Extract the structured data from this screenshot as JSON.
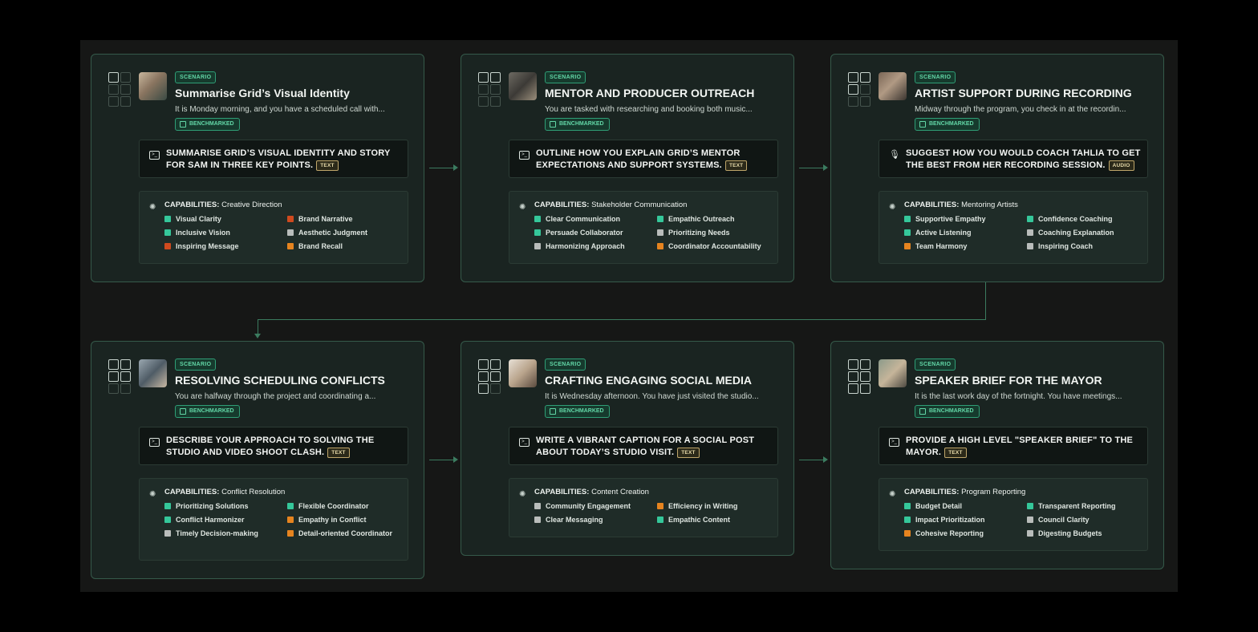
{
  "colors": {
    "green": "#35c79a",
    "orange": "#e6841f",
    "red": "#cf4a1e",
    "gray": "#b9bdbb",
    "connector": "#3b7b5f"
  },
  "labels": {
    "scenario": "SCENARIO",
    "benchmarked": "BENCHMARKED",
    "capabilities_prefix": "CAPABILITIES:"
  },
  "cards": [
    {
      "title": "Summarise Grid’s Visual Identity",
      "description": "It is Monday morning, and you have a scheduled call with...",
      "task_icon": "terminal-icon",
      "task": "SUMMARISE GRID’S VISUAL IDENTITY AND STORY FOR SAM IN THREE KEY POINTS.",
      "mode": "TEXT",
      "capability_area": "Creative Direction",
      "grid_icon_on": [
        true,
        false,
        false,
        false,
        false,
        false
      ],
      "capabilities": [
        {
          "label": "Visual Clarity",
          "color": "green"
        },
        {
          "label": "Brand Narrative",
          "color": "red"
        },
        {
          "label": "Inclusive Vision",
          "color": "green"
        },
        {
          "label": "Aesthetic Judgment",
          "color": "gray"
        },
        {
          "label": "Inspiring Message",
          "color": "red"
        },
        {
          "label": "Brand Recall",
          "color": "orange"
        }
      ]
    },
    {
      "title": "MENTOR AND PRODUCER OUTREACH",
      "description": "You are tasked with researching and booking both music...",
      "task_icon": "terminal-icon",
      "task": "OUTLINE HOW YOU EXPLAIN GRID’S MENTOR EXPECTATIONS AND SUPPORT SYSTEMS.",
      "mode": "TEXT",
      "capability_area": "Stakeholder Communication",
      "grid_icon_on": [
        true,
        true,
        false,
        false,
        false,
        false
      ],
      "capabilities": [
        {
          "label": "Clear Communication",
          "color": "green"
        },
        {
          "label": "Empathic Outreach",
          "color": "green"
        },
        {
          "label": "Persuade Collaborator",
          "color": "green"
        },
        {
          "label": "Prioritizing Needs",
          "color": "gray"
        },
        {
          "label": "Harmonizing Approach",
          "color": "gray"
        },
        {
          "label": "Coordinator Accountability",
          "color": "orange"
        }
      ]
    },
    {
      "title": "ARTIST SUPPORT DURING RECORDING",
      "description": "Midway through the program, you check in at the recordin...",
      "task_icon": "microphone-icon",
      "task": "SUGGEST HOW YOU WOULD COACH TAHLIA TO GET THE BEST FROM HER RECORDING SESSION.",
      "mode": "AUDIO",
      "capability_area": "Mentoring Artists",
      "grid_icon_on": [
        true,
        true,
        true,
        false,
        false,
        false
      ],
      "capabilities": [
        {
          "label": "Supportive Empathy",
          "color": "green"
        },
        {
          "label": "Confidence Coaching",
          "color": "green"
        },
        {
          "label": "Active Listening",
          "color": "green"
        },
        {
          "label": "Coaching Explanation",
          "color": "gray"
        },
        {
          "label": "Team Harmony",
          "color": "orange"
        },
        {
          "label": "Inspiring Coach",
          "color": "gray"
        }
      ]
    },
    {
      "title": "RESOLVING SCHEDULING CONFLICTS",
      "description": "You are halfway through the project and coordinating a...",
      "task_icon": "terminal-icon",
      "task": "DESCRIBE YOUR APPROACH TO SOLVING THE STUDIO AND VIDEO SHOOT CLASH.",
      "mode": "TEXT",
      "capability_area": "Conflict Resolution",
      "grid_icon_on": [
        true,
        true,
        true,
        true,
        false,
        false
      ],
      "capabilities": [
        {
          "label": "Prioritizing Solutions",
          "color": "green"
        },
        {
          "label": "Flexible Coordinator",
          "color": "green"
        },
        {
          "label": "Conflict Harmonizer",
          "color": "green"
        },
        {
          "label": "Empathy in Conflict",
          "color": "orange"
        },
        {
          "label": "Timely Decision-making",
          "color": "gray"
        },
        {
          "label": "Detail-oriented Coordinator",
          "color": "orange"
        }
      ]
    },
    {
      "title": "CRAFTING ENGAGING SOCIAL MEDIA",
      "description": "It is Wednesday afternoon. You have just visited the studio...",
      "task_icon": "terminal-icon",
      "task": "WRITE A VIBRANT CAPTION FOR A SOCIAL POST ABOUT TODAY’S STUDIO VISIT.",
      "mode": "TEXT",
      "capability_area": "Content Creation",
      "grid_icon_on": [
        true,
        true,
        true,
        true,
        true,
        false
      ],
      "capabilities": [
        {
          "label": "Community Engagement",
          "color": "gray"
        },
        {
          "label": "Efficiency in Writing",
          "color": "orange"
        },
        {
          "label": "Clear Messaging",
          "color": "gray"
        },
        {
          "label": "Empathic Content",
          "color": "green"
        }
      ]
    },
    {
      "title": "SPEAKER BRIEF FOR THE MAYOR",
      "description": "It is the last work day of the fortnight. You have meetings...",
      "task_icon": "terminal-icon",
      "task": "PROVIDE A HIGH LEVEL \"SPEAKER BRIEF\" TO THE MAYOR.",
      "mode": "TEXT",
      "capability_area": "Program Reporting",
      "grid_icon_on": [
        true,
        true,
        true,
        true,
        true,
        true
      ],
      "capabilities": [
        {
          "label": "Budget Detail",
          "color": "green"
        },
        {
          "label": "Transparent Reporting",
          "color": "green"
        },
        {
          "label": "Impact Prioritization",
          "color": "green"
        },
        {
          "label": "Council Clarity",
          "color": "gray"
        },
        {
          "label": "Cohesive Reporting",
          "color": "orange"
        },
        {
          "label": "Digesting Budgets",
          "color": "gray"
        }
      ]
    }
  ]
}
